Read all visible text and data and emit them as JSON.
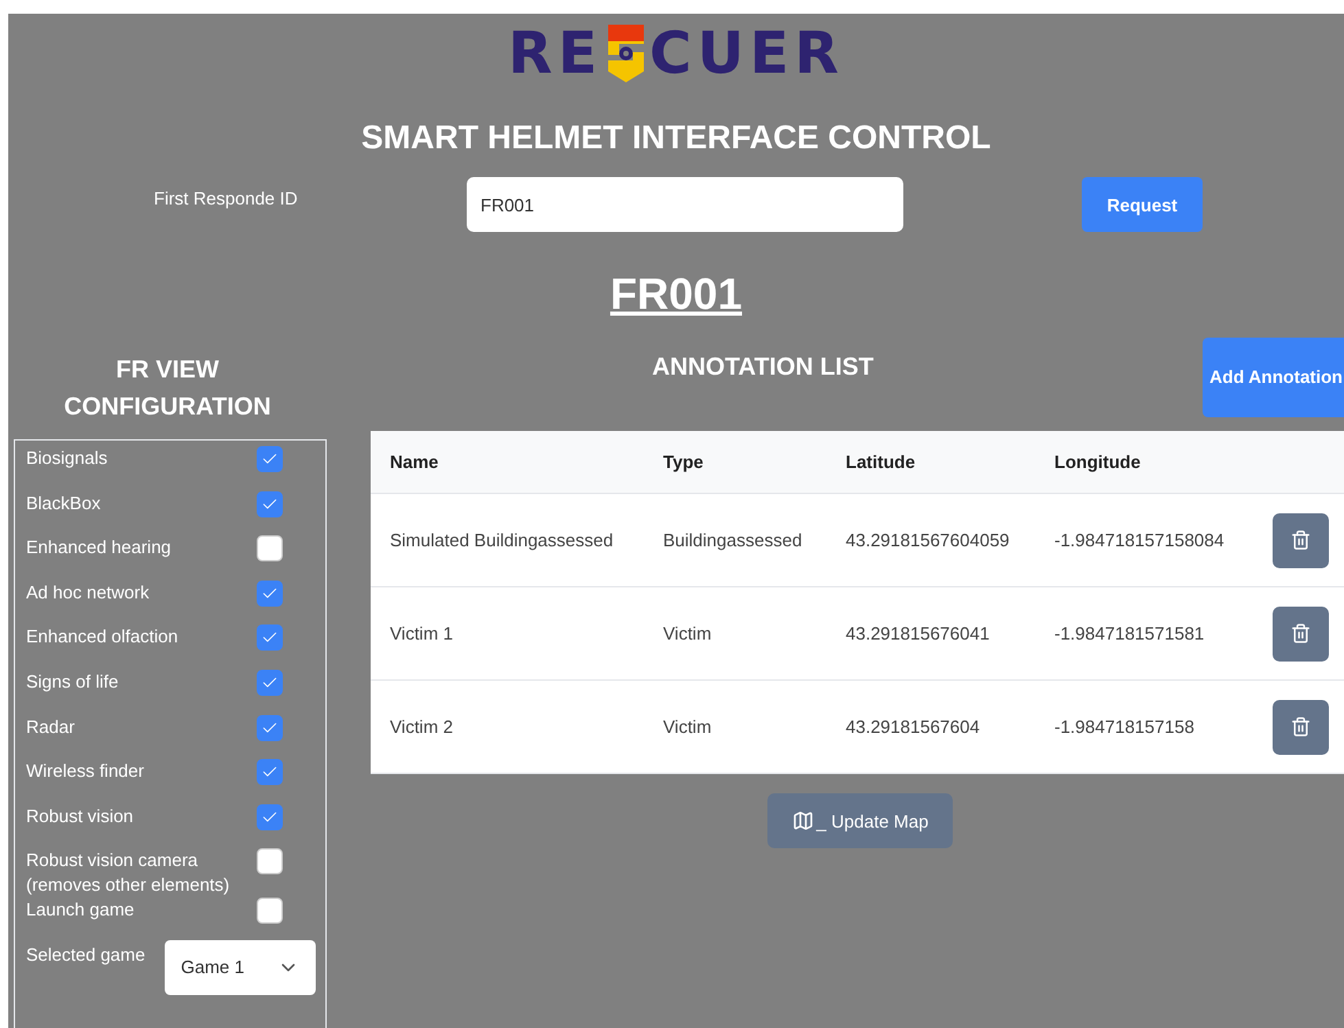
{
  "logo": {
    "left": "RE",
    "right": "CUER"
  },
  "title": "SMART HELMET INTERFACE CONTROL",
  "id_form": {
    "label": "First Responde ID",
    "value": "FR001",
    "button": "Request"
  },
  "current_id": "FR001",
  "config": {
    "title": "FR VIEW CONFIGURATION",
    "options": [
      {
        "label": "Biosignals",
        "checked": true
      },
      {
        "label": "BlackBox",
        "checked": true
      },
      {
        "label": "Enhanced hearing",
        "checked": false
      },
      {
        "label": "Ad hoc network",
        "checked": true
      },
      {
        "label": "Enhanced olfaction",
        "checked": true
      },
      {
        "label": "Signs of life",
        "checked": true
      },
      {
        "label": "Radar",
        "checked": true
      },
      {
        "label": "Wireless finder",
        "checked": true
      },
      {
        "label": "Robust vision",
        "checked": true
      },
      {
        "label": "Robust vision camera (removes other elements)",
        "checked": false
      },
      {
        "label": "Launch game",
        "checked": false
      }
    ],
    "game": {
      "label": "Selected game",
      "value": "Game 1"
    }
  },
  "annotations": {
    "title": "ANNOTATION LIST",
    "add_button": "Add Annotation",
    "columns": [
      "Name",
      "Type",
      "Latitude",
      "Longitude"
    ],
    "rows": [
      [
        "Simulated Buildingassessed",
        "Buildingassessed",
        "43.29181567604059",
        "-1.984718157158084"
      ],
      [
        "Victim 1",
        "Victim",
        "43.291815676041",
        "-1.9847181571581"
      ],
      [
        "Victim 2",
        "Victim",
        "43.29181567604",
        "-1.984718157158"
      ]
    ],
    "update_button": "_ Update Map"
  }
}
